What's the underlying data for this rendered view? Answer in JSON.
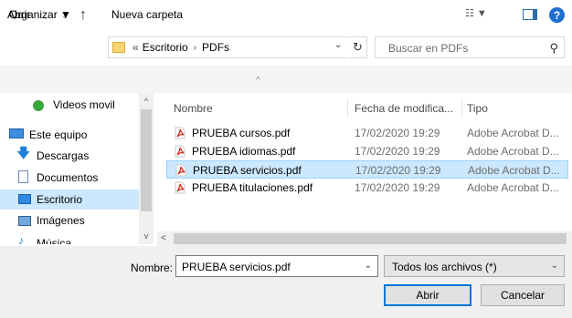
{
  "window": {
    "title": "Abrir",
    "close_glyph": "✕"
  },
  "nav": {
    "back_glyph": "←",
    "forward_glyph": "→",
    "recent_glyph": "⌄",
    "up_glyph": "↑",
    "address": {
      "chevron": "«",
      "path": [
        "Escritorio",
        "PDFs"
      ],
      "separator": "›"
    },
    "refresh_glyph": "↻",
    "search_placeholder": "Buscar en PDFs",
    "search_glyph": "⚲"
  },
  "toolbar": {
    "organize_label": "Organizar ▼",
    "new_folder_label": "Nueva carpeta",
    "view_label": "☷ ▼"
  },
  "sidebar": {
    "items": [
      {
        "label": "Videos movil",
        "icon": "green-circle-icon"
      },
      {
        "label": "Este equipo",
        "icon": "computer-icon"
      },
      {
        "label": "Descargas",
        "icon": "download-arrow-icon"
      },
      {
        "label": "Documentos",
        "icon": "document-icon"
      },
      {
        "label": "Escritorio",
        "icon": "desktop-icon",
        "selected": true
      },
      {
        "label": "Imágenes",
        "icon": "pictures-icon"
      },
      {
        "label": "Música",
        "icon": "music-icon"
      }
    ]
  },
  "filelist": {
    "columns": [
      "Nombre",
      "Fecha de modifica...",
      "Tipo"
    ],
    "sort_glyph": "^",
    "rows": [
      {
        "name": "PRUEBA cursos.pdf",
        "date": "17/02/2020 19:29",
        "type": "Adobe Acrobat D...",
        "selected": false
      },
      {
        "name": "PRUEBA idiomas.pdf",
        "date": "17/02/2020 19:29",
        "type": "Adobe Acrobat D...",
        "selected": false
      },
      {
        "name": "PRUEBA servicios.pdf",
        "date": "17/02/2020 19:29",
        "type": "Adobe Acrobat D...",
        "selected": true
      },
      {
        "name": "PRUEBA titulaciones.pdf",
        "date": "17/02/2020 19:29",
        "type": "Adobe Acrobat D...",
        "selected": false
      }
    ]
  },
  "footer": {
    "filename_label": "Nombre:",
    "filename_value": "PRUEBA servicios.pdf",
    "filter_value": "Todos los archivos (*)",
    "open_label": "Abrir",
    "cancel_label": "Cancelar"
  },
  "colors": {
    "accent": "#0078d7",
    "selection": "#cce8ff",
    "selection_border": "#99d1ff",
    "pdf_red": "#d52b1e"
  }
}
